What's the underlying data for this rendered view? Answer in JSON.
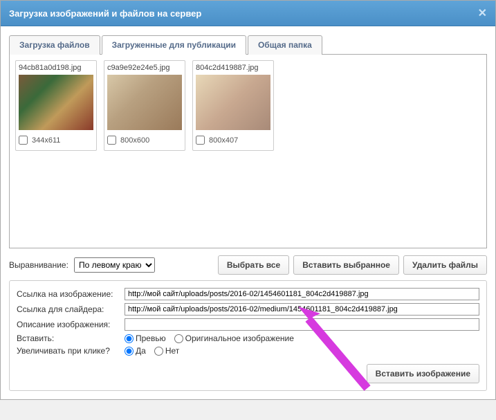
{
  "dialog": {
    "title": "Загрузка изображений и файлов на сервер"
  },
  "tabs": [
    {
      "label": "Загрузка файлов"
    },
    {
      "label": "Загруженные для публикации"
    },
    {
      "label": "Общая папка"
    }
  ],
  "thumbs": [
    {
      "name": "94cb81a0d198.jpg",
      "size": "344x611"
    },
    {
      "name": "c9a9e92e24e5.jpg",
      "size": "800x600"
    },
    {
      "name": "804c2d419887.jpg",
      "size": "800x407"
    }
  ],
  "align": {
    "label": "Выравнивание:",
    "value": "По левому краю"
  },
  "buttons": {
    "select_all": "Выбрать все",
    "insert_selected": "Вставить выбранное",
    "delete_files": "Удалить файлы",
    "insert_image": "Вставить изображение"
  },
  "form": {
    "image_link_label": "Ссылка на изображение:",
    "image_link_value": "http://мой сайт/uploads/posts/2016-02/1454601181_804c2d419887.jpg",
    "slider_link_label": "Ссылка для слайдера:",
    "slider_link_value": "http://мой сайт/uploads/posts/2016-02/medium/1454601181_804c2d419887.jpg",
    "description_label": "Описание изображения:",
    "description_value": "",
    "insert_label": "Вставить:",
    "insert_preview": "Превью",
    "insert_original": "Оригинальное изображение",
    "zoom_label": "Увеличивать при клике?",
    "zoom_yes": "Да",
    "zoom_no": "Нет"
  }
}
